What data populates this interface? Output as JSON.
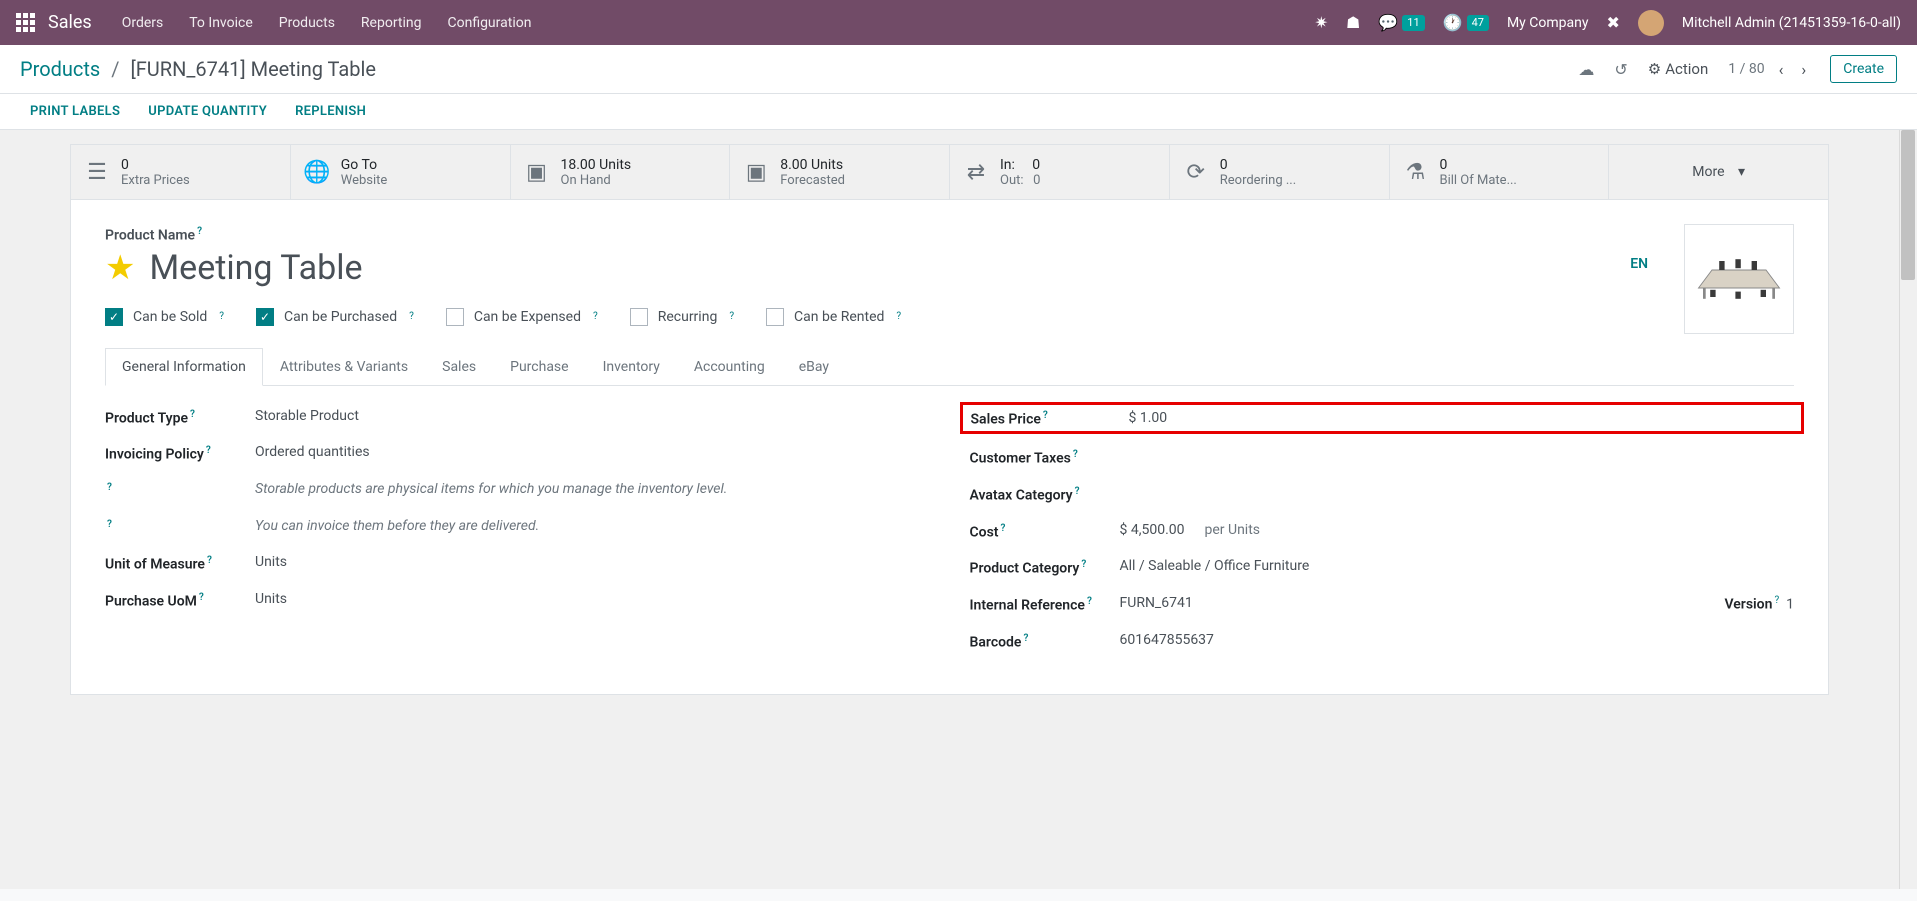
{
  "topbar": {
    "brand": "Sales",
    "menu": [
      "Orders",
      "To Invoice",
      "Products",
      "Reporting",
      "Configuration"
    ],
    "messages_count": "11",
    "activities_count": "47",
    "company": "My Company",
    "user": "Mitchell Admin (21451359-16-0-all)"
  },
  "breadcrumb": {
    "back": "Products",
    "current": "[FURN_6741] Meeting Table"
  },
  "action_label": "Action",
  "pager": {
    "pos": "1 / 80"
  },
  "create_label": "Create",
  "action_links": [
    "PRINT LABELS",
    "UPDATE QUANTITY",
    "REPLENISH"
  ],
  "stats": [
    {
      "l1": "0",
      "l2": "Extra Prices"
    },
    {
      "l1": "Go To",
      "l2": "Website"
    },
    {
      "l1": "18.00 Units",
      "l2": "On Hand"
    },
    {
      "l1": "8.00 Units",
      "l2": "Forecasted"
    },
    {
      "l1": "In:     0",
      "l2": "Out:   0"
    },
    {
      "l1": "0",
      "l2": "Reordering ..."
    },
    {
      "l1": "0",
      "l2": "Bill Of Mate..."
    }
  ],
  "more_label": "More",
  "product": {
    "name_label": "Product Name",
    "name": "Meeting Table",
    "lang": "EN",
    "checks": [
      {
        "label": "Can be Sold",
        "checked": true
      },
      {
        "label": "Can be Purchased",
        "checked": true
      },
      {
        "label": "Can be Expensed",
        "checked": false
      },
      {
        "label": "Recurring",
        "checked": false
      },
      {
        "label": "Can be Rented",
        "checked": false
      }
    ],
    "tabs": [
      "General Information",
      "Attributes & Variants",
      "Sales",
      "Purchase",
      "Inventory",
      "Accounting",
      "eBay"
    ],
    "left": [
      {
        "label": "Product Type",
        "value": "Storable Product"
      },
      {
        "label": "Invoicing Policy",
        "value": "Ordered quantities"
      },
      {
        "label": "",
        "value": "Storable products are physical items for which you manage the inventory level.",
        "italic": true
      },
      {
        "label": "",
        "value": "You can invoice them before they are delivered.",
        "italic": true
      },
      {
        "label": "Unit of Measure",
        "value": "Units"
      },
      {
        "label": "Purchase UoM",
        "value": "Units"
      }
    ],
    "right": {
      "sales_price_label": "Sales Price",
      "sales_price": "$ 1.00",
      "customer_taxes_label": "Customer Taxes",
      "avatax_label": "Avatax Category",
      "cost_label": "Cost",
      "cost": "$ 4,500.00",
      "cost_per": "per Units",
      "category_label": "Product Category",
      "category": "All / Saleable / Office Furniture",
      "ref_label": "Internal Reference",
      "ref": "FURN_6741",
      "version_label": "Version",
      "version": "1",
      "barcode_label": "Barcode",
      "barcode": "601647855637"
    }
  }
}
